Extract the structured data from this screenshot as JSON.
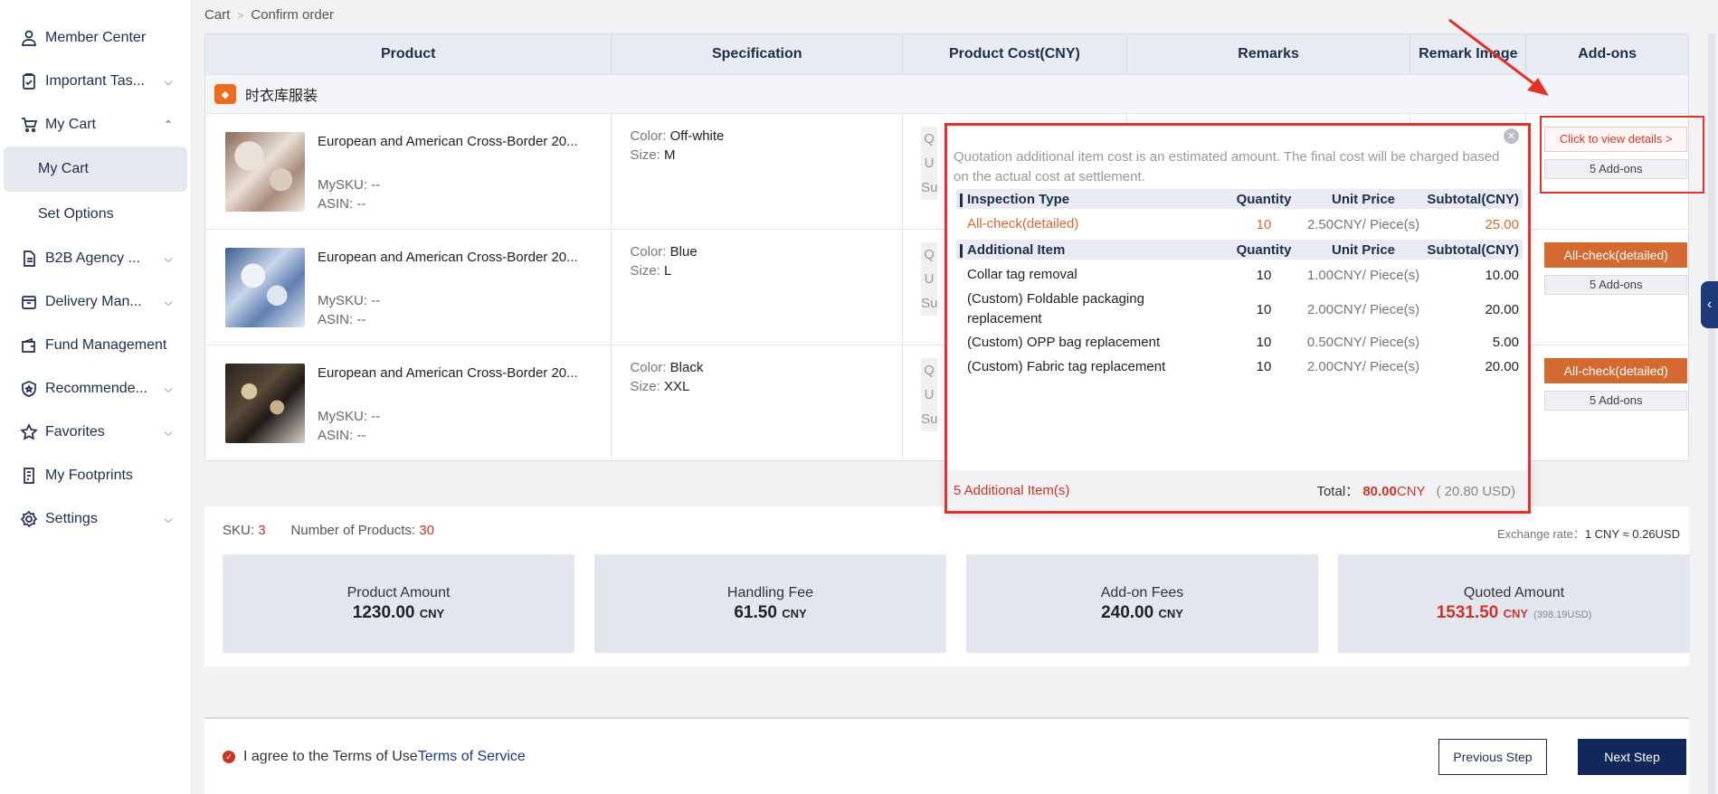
{
  "sidebar": {
    "items": [
      {
        "label": "Member Center",
        "icon": "user-icon",
        "chevron": ""
      },
      {
        "label": "Important Tas...",
        "icon": "clipboard-icon",
        "chevron": "down"
      },
      {
        "label": "My Cart",
        "icon": "cart-icon",
        "chevron": "up"
      },
      {
        "label": "B2B Agency ...",
        "icon": "document-icon",
        "chevron": "down"
      },
      {
        "label": "Delivery Man...",
        "icon": "delivery-icon",
        "chevron": "down"
      },
      {
        "label": "Fund Management",
        "icon": "wallet-icon",
        "chevron": ""
      },
      {
        "label": "Recommende...",
        "icon": "badge-icon",
        "chevron": "down"
      },
      {
        "label": "Favorites",
        "icon": "star-icon",
        "chevron": "down"
      },
      {
        "label": "My Footprints",
        "icon": "footprint-icon",
        "chevron": ""
      },
      {
        "label": "Settings",
        "icon": "gear-icon",
        "chevron": "down"
      }
    ],
    "sub_items": [
      {
        "label": "My Cart",
        "active": true
      },
      {
        "label": "Set Options",
        "active": false
      }
    ]
  },
  "breadcrumb": {
    "first": "Cart",
    "second": "Confirm order"
  },
  "table": {
    "headers": [
      "Product",
      "Specification",
      "Product Cost(CNY)",
      "Remarks",
      "Remark Image",
      "Add-ons"
    ],
    "store_name": "时衣库服装",
    "rows": [
      {
        "name": "European and American Cross-Border 20...",
        "mysku": "MySKU: --",
        "asin": "ASIN: --",
        "color_key": "Color:",
        "color": "Off-white",
        "size_key": "Size:",
        "size": "M",
        "addon_button": "Click to view details >",
        "addon_count": "5",
        "addon_label": "Add-ons"
      },
      {
        "name": "European and American Cross-Border 20...",
        "mysku": "MySKU: --",
        "asin": "ASIN: --",
        "color_key": "Color:",
        "color": "Blue",
        "size_key": "Size:",
        "size": "L",
        "addon_button": "All-check(detailed)",
        "addon_count": "5",
        "addon_label": "Add-ons"
      },
      {
        "name": "European and American Cross-Border 20...",
        "mysku": "MySKU: --",
        "asin": "ASIN: --",
        "color_key": "Color:",
        "color": "Black",
        "size_key": "Size:",
        "size": "XXL",
        "addon_button": "All-check(detailed)",
        "addon_count": "5",
        "addon_label": "Add-ons"
      }
    ],
    "cost_stub": [
      "Q",
      "U",
      "Su"
    ]
  },
  "popup": {
    "note": "Quotation additional item cost is an estimated amount. The final cost will be charged based on the actual cost at settlement.",
    "inspection_header": {
      "a": "Inspection Type",
      "q": "Quantity",
      "u": "Unit Price",
      "s": "Subtotal(CNY)"
    },
    "inspection_rows": [
      {
        "a": "All-check(detailed)",
        "q": "10",
        "u": "2.50CNY/ Piece(s)",
        "s": "25.00"
      }
    ],
    "additional_header": {
      "a": "Additional Item",
      "q": "Quantity",
      "u": "Unit Price",
      "s": "Subtotal(CNY)"
    },
    "additional_rows": [
      {
        "a": "Collar tag removal",
        "q": "10",
        "u": "1.00CNY/ Piece(s)",
        "s": "10.00"
      },
      {
        "a": "(Custom) Foldable packaging replacement",
        "q": "10",
        "u": "2.00CNY/ Piece(s)",
        "s": "20.00"
      },
      {
        "a": "(Custom) OPP bag replacement",
        "q": "10",
        "u": "0.50CNY/ Piece(s)",
        "s": "5.00"
      },
      {
        "a": "(Custom) Fabric tag replacement",
        "q": "10",
        "u": "2.00CNY/ Piece(s)",
        "s": "20.00"
      }
    ],
    "footer_count": "5 Additional Item(s)",
    "total_label": "Total：",
    "total_value": "80.00",
    "total_currency": "CNY",
    "total_usd": "( 20.80 USD)"
  },
  "summary": {
    "sku_label": "SKU:",
    "sku_value": "3",
    "products_label": "Number of Products:",
    "products_value": "30",
    "exrate_label": "Exchange rate：",
    "exrate_value": "1 CNY ≈ 0.26USD",
    "cards": [
      {
        "title": "Product Amount",
        "value": "1230.00",
        "currency": "CNY"
      },
      {
        "title": "Handling Fee",
        "value": "61.50",
        "currency": "CNY"
      },
      {
        "title": "Add-on Fees",
        "value": "240.00",
        "currency": "CNY"
      },
      {
        "title": "Quoted Amount",
        "value": "1531.50",
        "currency": "CNY",
        "usd": "(398.19USD)"
      }
    ]
  },
  "footer": {
    "agree_text": "I agree to the Terms of Use",
    "agree_link": "Terms of Service",
    "prev": "Previous Step",
    "next": "Next Step"
  },
  "colors": {
    "accent": "#13285a",
    "danger": "#e2322c",
    "orange": "#d26a32"
  }
}
